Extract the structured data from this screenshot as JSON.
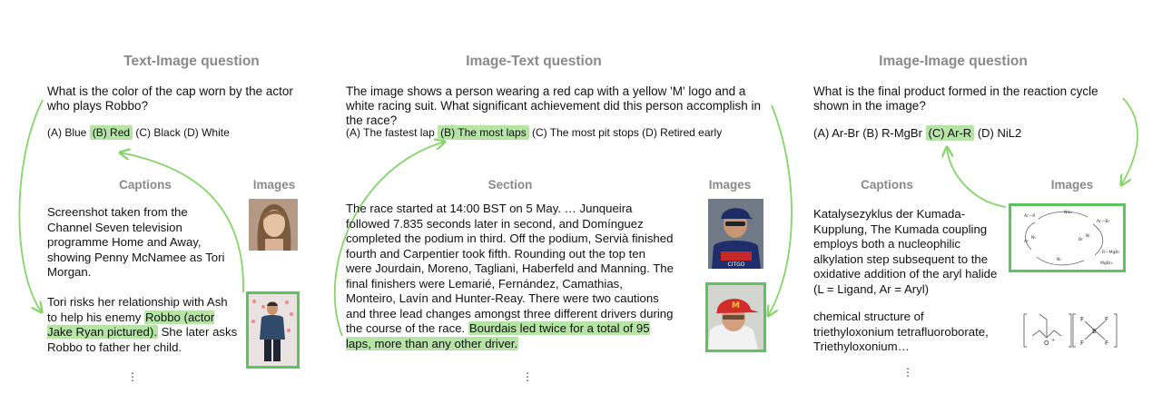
{
  "colors": {
    "highlight": "#b6e3a6",
    "arrow": "#86d46a",
    "frame": "#5cc45c",
    "heading": "#8a8a8a"
  },
  "panels": [
    {
      "title": "Text-Image question",
      "question": "What is the color of the cap worn by the actor who plays Robbo?",
      "options": [
        {
          "label": "(A) Blue",
          "correct": false
        },
        {
          "label": "(B) Red",
          "correct": true
        },
        {
          "label": "(C) Black",
          "correct": false
        },
        {
          "label": "(D) White",
          "correct": false
        }
      ],
      "left_heading": "Captions",
      "right_heading": "Images",
      "caption1": "Screenshot taken from the Channel Seven television programme Home and Away, showing Penny McNamee as Tori Morgan.",
      "caption2_before": "Tori risks her relationship with Ash to help his enemy ",
      "caption2_highlight": "Robbo (actor Jake Ryan pictured).",
      "caption2_after": " She later asks Robbo to father her child.",
      "ellipsis": "⋮"
    },
    {
      "title": "Image-Text question",
      "question": "The image shows a person wearing a red cap with a yellow 'M' logo and a white racing suit. What significant achievement did this person accomplish in the race?",
      "options": [
        {
          "label": "(A)  The fastest lap",
          "correct": false
        },
        {
          "label": "(B) The most laps",
          "correct": true
        },
        {
          "label": "(C) The most pit stops",
          "correct": false
        },
        {
          "label": "(D) Retired early",
          "correct": false
        }
      ],
      "left_heading": "Section",
      "right_heading": "Images",
      "section_before": "The race started at 14:00 BST on 5 May. … Junqueira followed 7.835 seconds later in second, and Domínguez completed the podium in third. Off the podium, Servià finished fourth and Carpentier took fifth. Rounding out the top ten were Jourdain, Moreno, Tagliani, Haberfeld and Manning. The final finishers were Lemarié, Fernández, Camathias, Monteiro, Lavín and Hunter-Reay. There were two cautions and three lead changes amongst three different drivers during the course of the race. ",
      "section_highlight": "Bourdais led twice for a total of 95 laps, more than any other driver.",
      "ellipsis": "⋮"
    },
    {
      "title": "Image-Image question",
      "question": "What is the final product formed in the reaction cycle shown in the image?",
      "options": [
        {
          "label": "(A) Ar-Br",
          "correct": false
        },
        {
          "label": "(B) R-MgBr",
          "correct": false
        },
        {
          "label": "(C) Ar-R",
          "correct": true
        },
        {
          "label": "(D) NiL2",
          "correct": false
        }
      ],
      "left_heading": "Captions",
      "right_heading": "Images",
      "caption1": "Katalysezyklus der Kumada-Kupplung, The Kumada coupling employs both a nucleophilic alkylation step subsequent to the oxidative addition of the aryl halide (L = Ligand, Ar = Aryl)",
      "caption2": "chemical structure of triethyloxonium tetrafluoroborate, Triethyloxonium…",
      "ellipsis": "⋮"
    }
  ]
}
